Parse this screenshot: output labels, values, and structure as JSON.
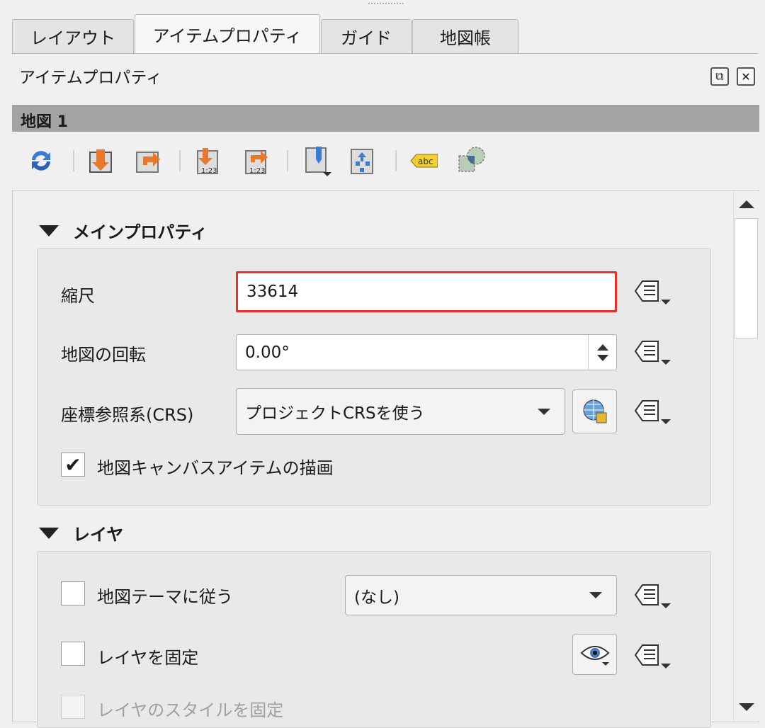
{
  "tabs": [
    "レイアウト",
    "アイテムプロパティ",
    "ガイド",
    "地図帳"
  ],
  "panel_title": "アイテムプロパティ",
  "item_header": "地図 1",
  "toolbar": {
    "icons": [
      "refresh-icon",
      "set-extent-from-canvas-icon",
      "view-extent-in-canvas-icon",
      "set-scale-from-canvas-icon",
      "set-canvas-scale-icon",
      "bookmark-icon",
      "move-content-icon",
      "label-settings-icon",
      "clipping-settings-icon"
    ],
    "label_icon_text": "abc",
    "scale_text": "1:23"
  },
  "main": {
    "title": "メインプロパティ",
    "scale_label": "縮尺",
    "scale_value": "33614",
    "rotation_label": "地図の回転",
    "rotation_value": "0.00°",
    "crs_label": "座標参照系(CRS)",
    "crs_value": "プロジェクトCRSを使う",
    "draw_items_label": "地図キャンバスアイテムの描画",
    "draw_items_checked": true
  },
  "layers": {
    "title": "レイヤ",
    "follow_theme_label": "地図テーマに従う",
    "theme_value": "(なし)",
    "lock_layers_label": "レイヤを固定",
    "lock_styles_label": "レイヤのスタイルを固定"
  },
  "colors": {
    "highlight": "#e8302a",
    "header": "#a3a3a3"
  }
}
